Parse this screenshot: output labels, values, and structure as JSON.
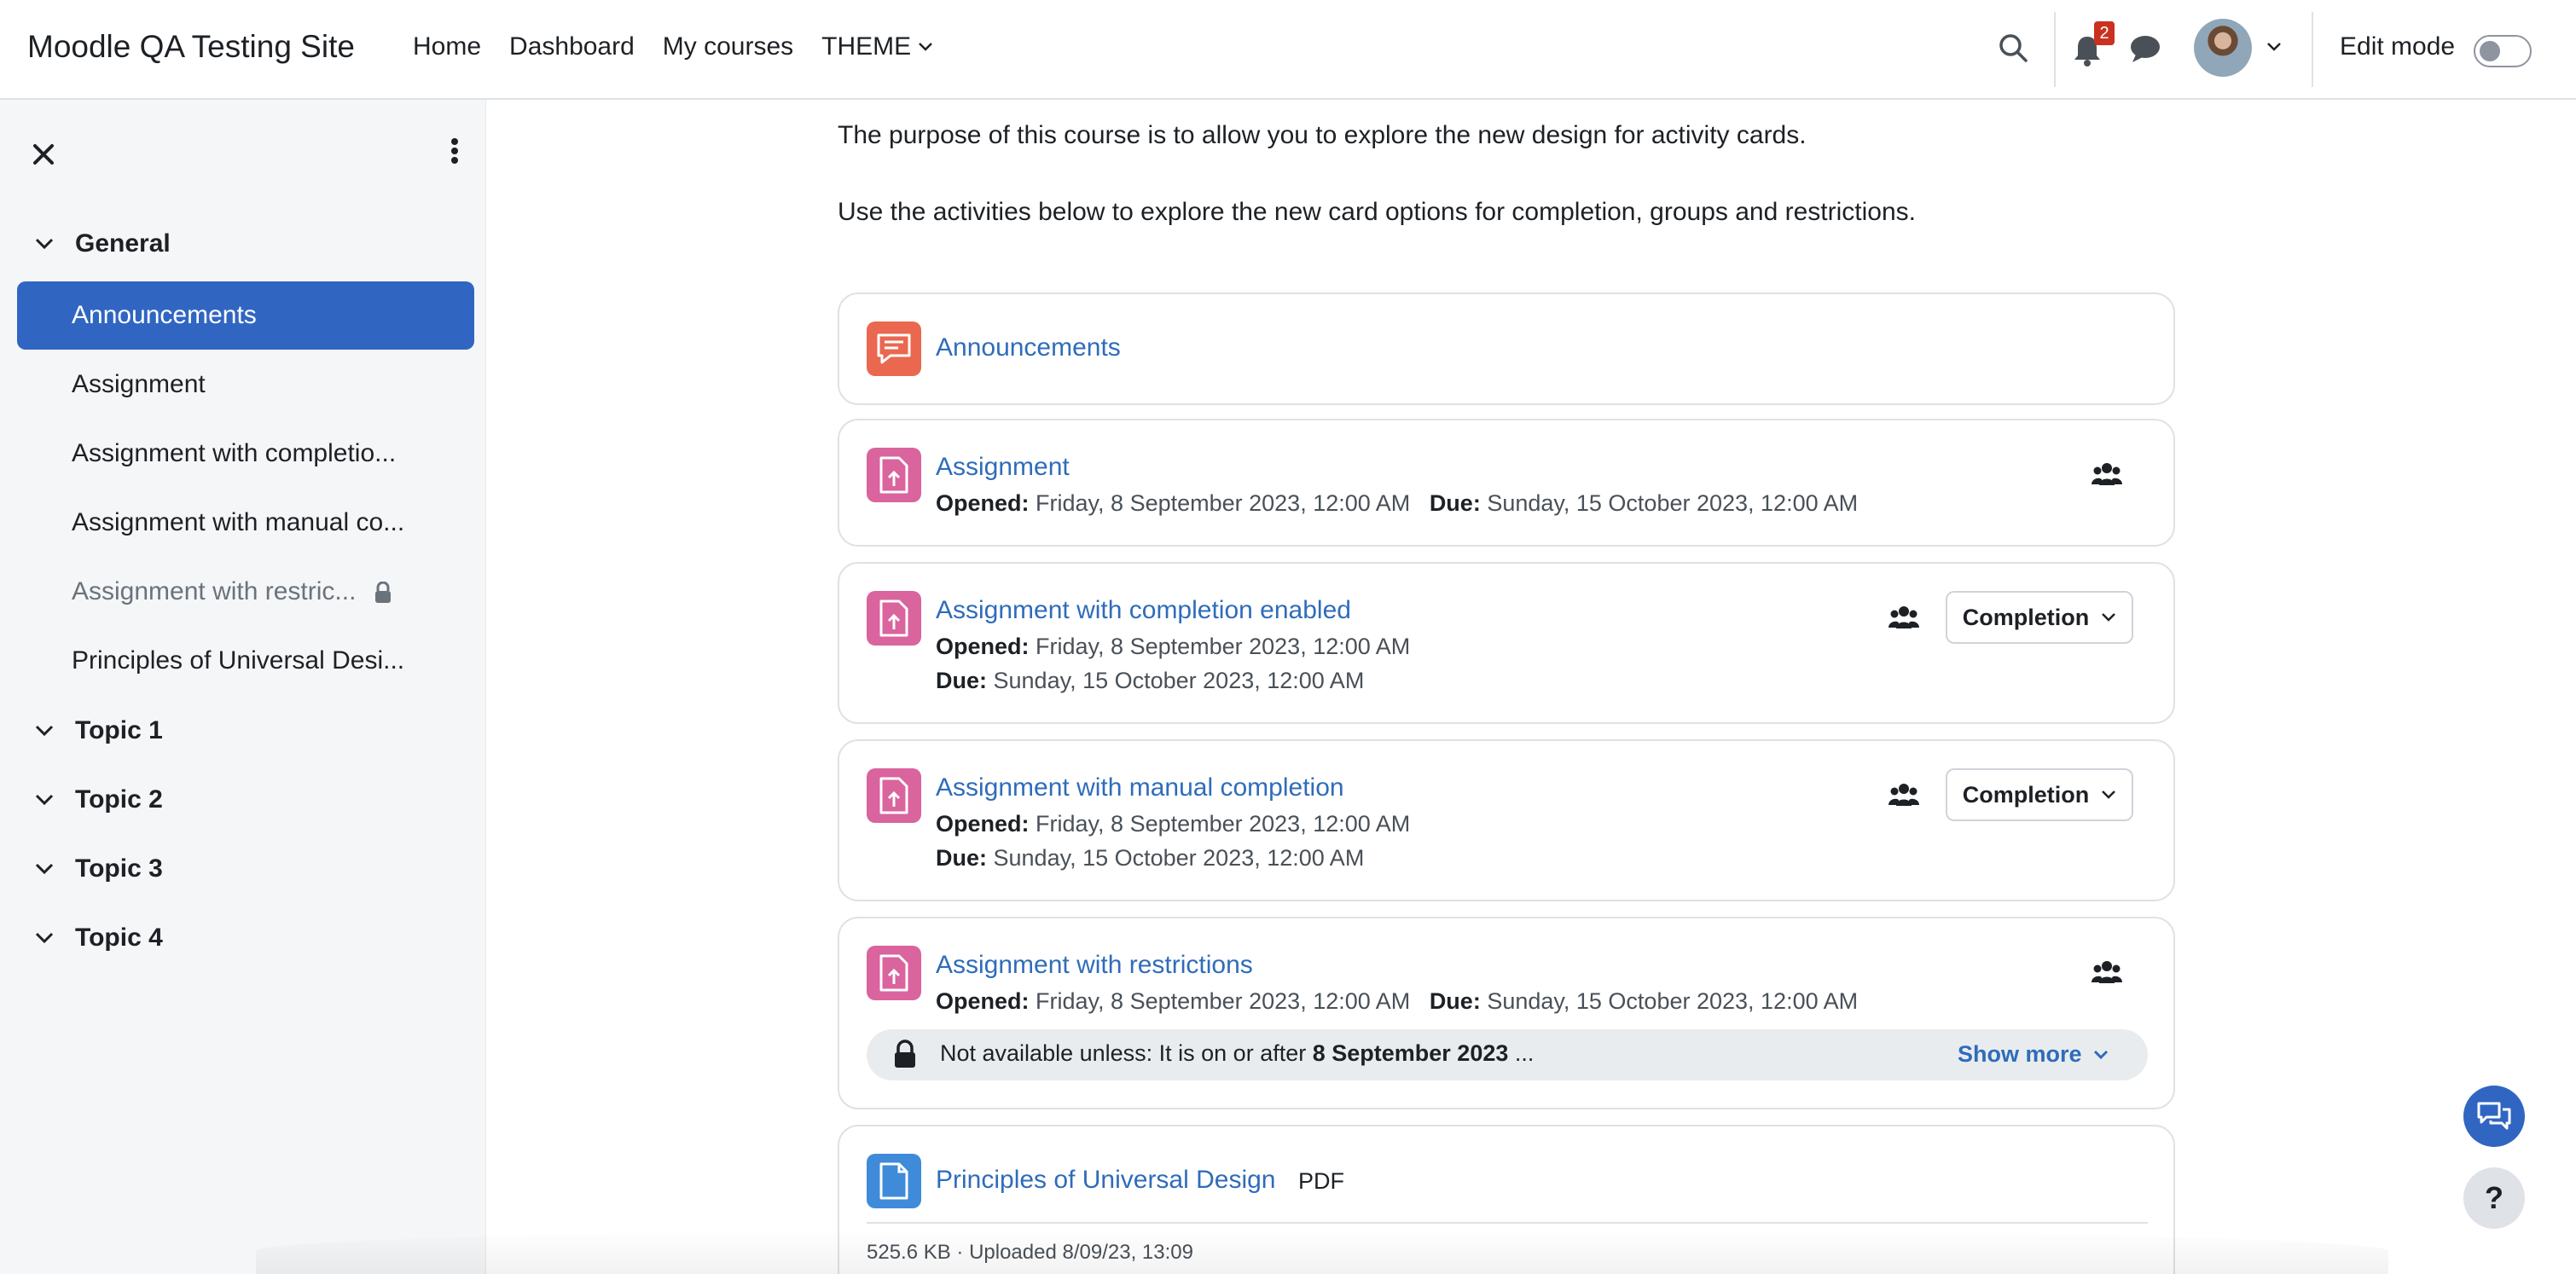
{
  "navbar": {
    "site_name": "Moodle QA Testing Site",
    "links": [
      "Home",
      "Dashboard",
      "My courses",
      "THEME"
    ],
    "notification_count": "2",
    "edit_mode_label": "Edit mode",
    "edit_mode_on": false
  },
  "sidebar": {
    "sections": {
      "general": "General",
      "topic1": "Topic 1",
      "topic2": "Topic 2",
      "topic3": "Topic 3",
      "topic4": "Topic 4"
    },
    "items": [
      {
        "label": "Announcements",
        "state": "active"
      },
      {
        "label": "Assignment",
        "state": "normal"
      },
      {
        "label": "Assignment with completio...",
        "state": "normal"
      },
      {
        "label": "Assignment with manual co...",
        "state": "normal"
      },
      {
        "label": "Assignment with restric...",
        "state": "restricted"
      },
      {
        "label": "Principles of Universal Desi...",
        "state": "normal"
      }
    ]
  },
  "main": {
    "intro_1": "The purpose of this course is to allow you to explore the new design for activity cards.",
    "intro_2": "Use the activities below to explore the new card options for completion, groups and restrictions.",
    "labels": {
      "opened": "Opened:",
      "due": "Due:"
    },
    "activities": [
      {
        "title": "Announcements",
        "icon": "forum-icon"
      },
      {
        "title": "Assignment",
        "opened": "Friday, 8 September 2023, 12:00 AM",
        "due": "Sunday, 15 October 2023, 12:00 AM"
      },
      {
        "title": "Assignment with completion enabled",
        "opened": "Friday, 8 September 2023, 12:00 AM",
        "due": "Sunday, 15 October 2023, 12:00 AM",
        "completion_label": "Completion"
      },
      {
        "title": "Assignment with manual completion",
        "opened": "Friday, 8 September 2023, 12:00 AM",
        "due": "Sunday, 15 October 2023, 12:00 AM",
        "completion_label": "Completion"
      },
      {
        "title": "Assignment with restrictions",
        "opened": "Friday, 8 September 2023, 12:00 AM",
        "due": "Sunday, 15 October 2023, 12:00 AM",
        "restriction_prefix": "Not available unless: It is on or after ",
        "restriction_date": "8 September 2023",
        "restriction_suffix": " ...",
        "show_more": "Show more"
      },
      {
        "title": "Principles of Universal Design",
        "type_tag": "PDF",
        "meta": "525.6 KB · Uploaded 8/09/23, 13:09"
      }
    ]
  },
  "colors": {
    "accent": "#3066c2",
    "link": "#2f6cba",
    "forum": "#e9684f",
    "assign": "#d9649e",
    "resource": "#3f8bd9"
  }
}
